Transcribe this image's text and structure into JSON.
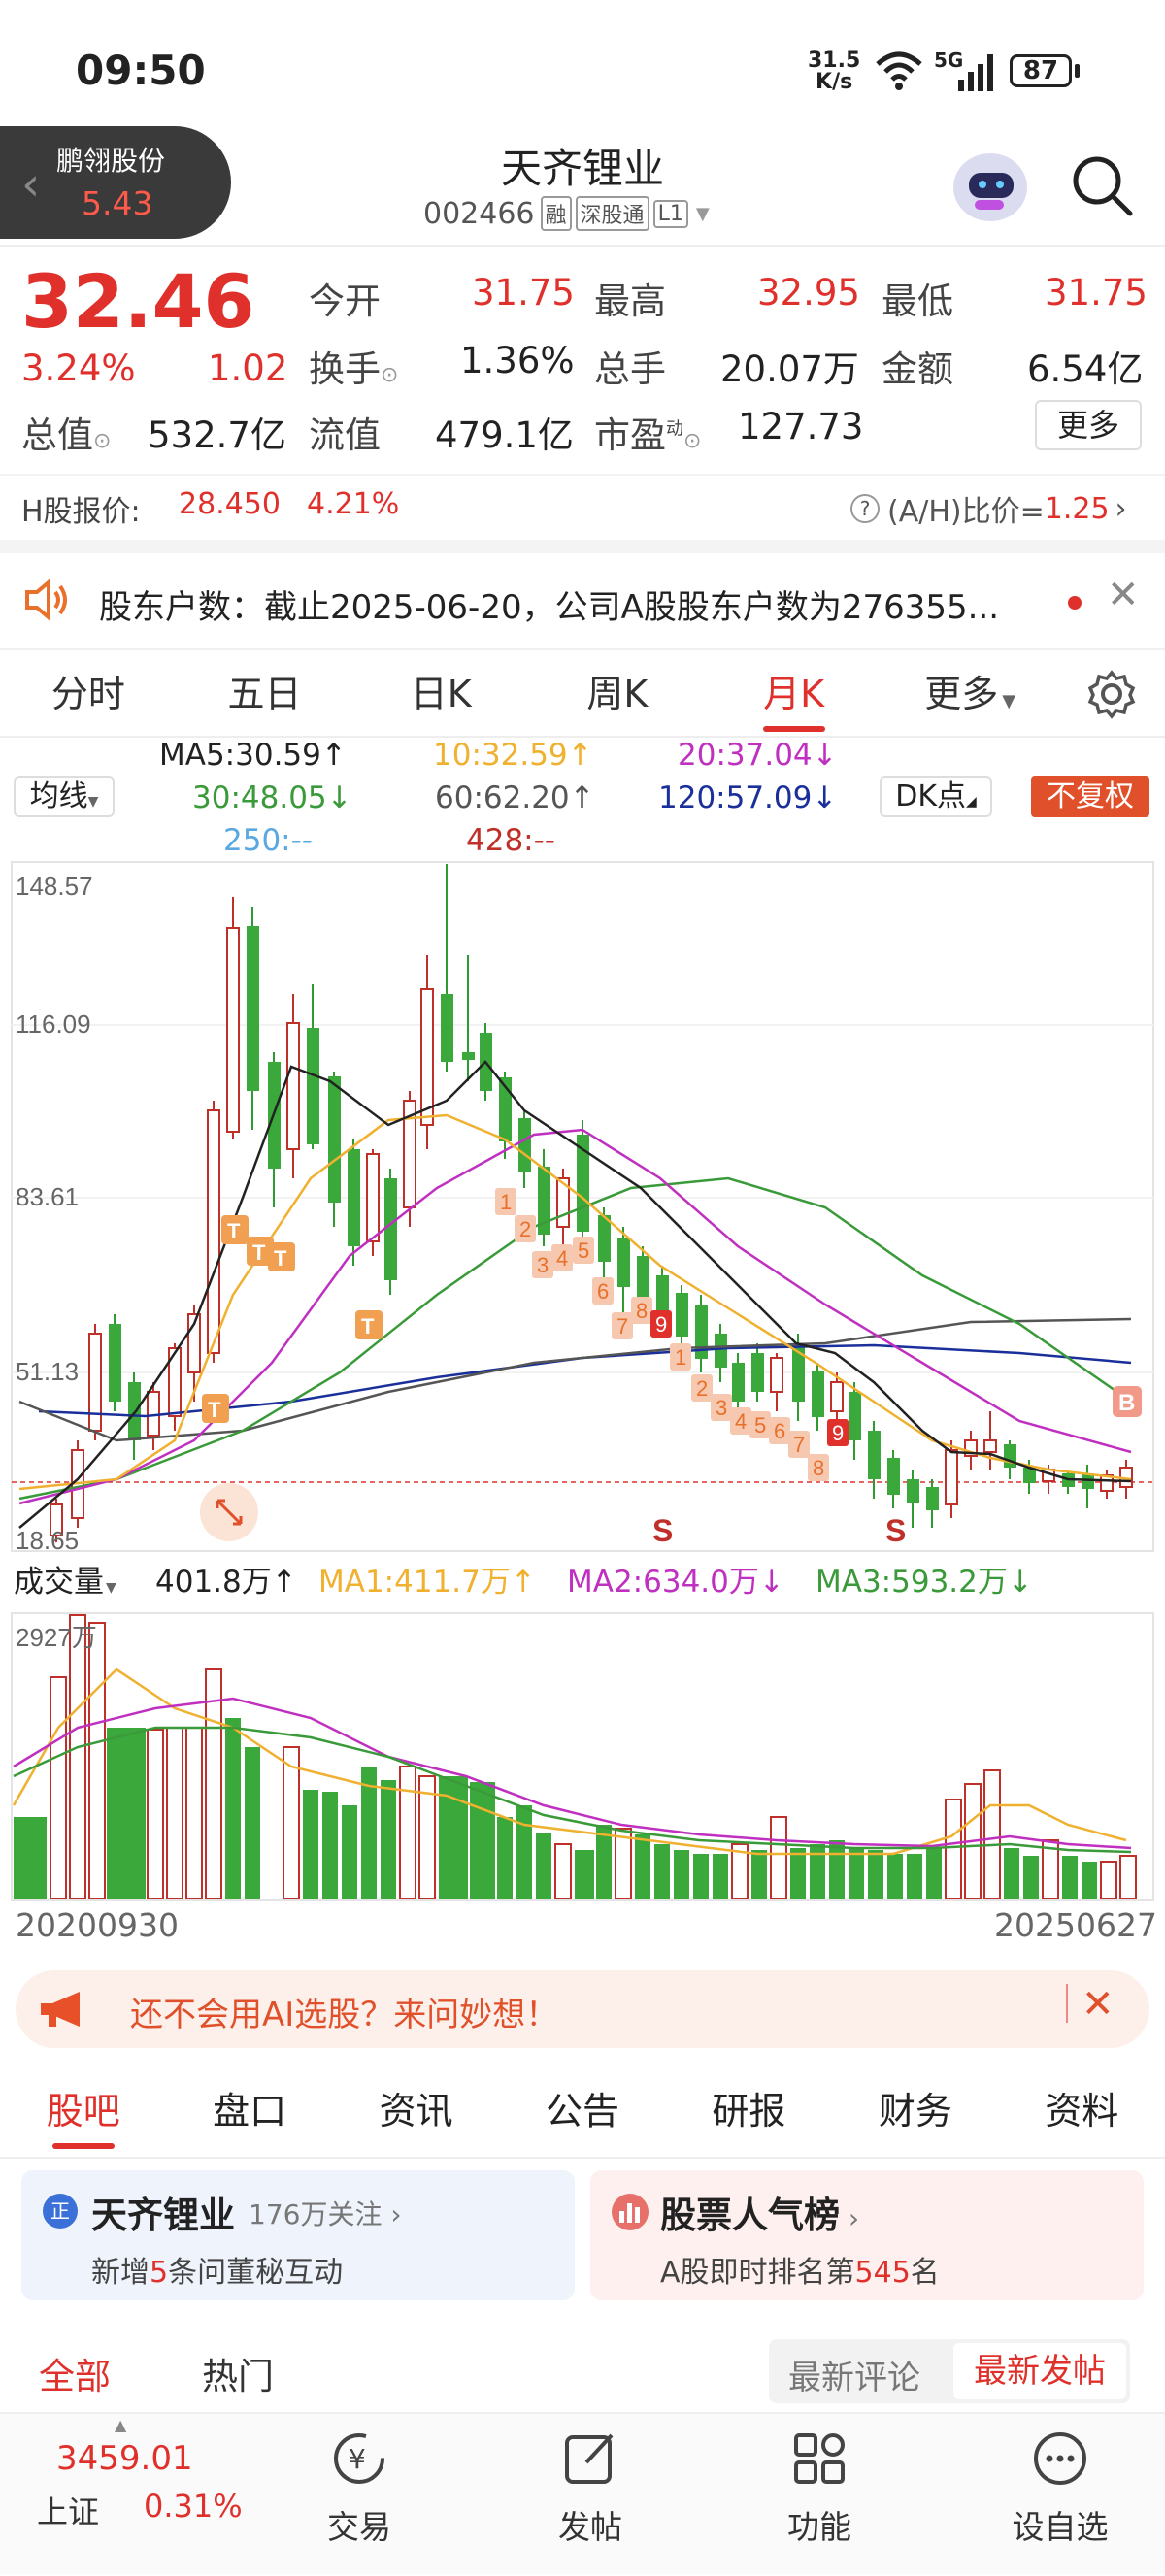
{
  "status_bar": {
    "time": "09:50",
    "net_speed_top": "31.5",
    "net_speed_bottom": "K/s",
    "signal": "5G",
    "battery": "87"
  },
  "header": {
    "prev_stock": {
      "name": "鹏翎股份",
      "price": "5.43"
    },
    "title": "天齐锂业",
    "code": "002466",
    "tags": [
      "融",
      "深股通",
      "L1"
    ]
  },
  "quote": {
    "price": "32.46",
    "change_pct": "3.24%",
    "change": "1.02",
    "open_label": "今开",
    "open": "31.75",
    "high_label": "最高",
    "high": "32.95",
    "low_label": "最低",
    "low": "31.75",
    "turnover_label": "换手",
    "turnover": "1.36%",
    "volume_label": "总手",
    "volume": "20.07万",
    "amount_label": "金额",
    "amount": "6.54亿",
    "mktcap_label": "总值",
    "mktcap": "532.7亿",
    "float_label": "流值",
    "float": "479.1亿",
    "pe_label": "市盈",
    "pe_sup": "动",
    "pe": "127.73",
    "more": "更多"
  },
  "h_share": {
    "label": "H股报价:",
    "price": "28.450",
    "pct": "4.21%",
    "ratio_label": "(A/H)比价=",
    "ratio": "1.25"
  },
  "notice": {
    "text": "股东户数：截止2025-06-20，公司A股股东户数为276355..."
  },
  "chart_tabs": [
    "分时",
    "五日",
    "日K",
    "周K",
    "月K",
    "更多"
  ],
  "active_tab": "月K",
  "ma_bar": {
    "type": "均线",
    "ma5": "MA5:30.59↑",
    "ma10": "10:32.59↑",
    "ma20": "20:37.04↓",
    "ma30": "30:48.05↓",
    "ma60": "60:62.20↑",
    "ma120": "120:57.09↓",
    "ma250": "250:--",
    "ma428": "428:--",
    "dk": "DK点",
    "adjust": "不复权"
  },
  "price_axis": [
    "148.57",
    "116.09",
    "83.61",
    "51.13",
    "18.65"
  ],
  "kline_marks": {
    "s": "S",
    "b": "B",
    "t": "T"
  },
  "volume_bar": {
    "label": "成交量",
    "value": "401.8万↑",
    "ma1": "MA1:411.7万↑",
    "ma2": "MA2:634.0万↓",
    "ma3": "MA3:593.2万↓",
    "max": "2927万"
  },
  "date_range": {
    "start": "20200930",
    "end": "20250627"
  },
  "ai_banner": {
    "text": "还不会用AI选股？来问妙想！"
  },
  "sub_tabs": [
    "股吧",
    "盘口",
    "资讯",
    "公告",
    "研报",
    "财务",
    "资料"
  ],
  "cards": {
    "left": {
      "badge": "正",
      "title": "天齐锂业",
      "follow": "176万关注",
      "desc_pre": "新增",
      "desc_num": "5",
      "desc_post": "条问董秘互动"
    },
    "right": {
      "title": "股票人气榜",
      "desc_pre": "A股即时排名第",
      "desc_num": "545",
      "desc_post": "名"
    }
  },
  "feed_tabs": {
    "all": "全部",
    "hot": "热门",
    "latest_comment": "最新评论",
    "latest_post": "最新发帖"
  },
  "bottom_nav": {
    "index_value": "3459.01",
    "index_name": "上证",
    "index_pct": "0.31%",
    "items": [
      "交易",
      "发帖",
      "功能",
      "设自选"
    ]
  },
  "colors": {
    "up": "#e0302b",
    "down": "#2f9a2f",
    "accent": "#e0302b",
    "ma5": "#222",
    "ma10": "#f0b030",
    "ma20": "#c030c0",
    "ma30": "#3a9a3a",
    "ma60": "#555",
    "ma120": "#1a2f9a"
  }
}
